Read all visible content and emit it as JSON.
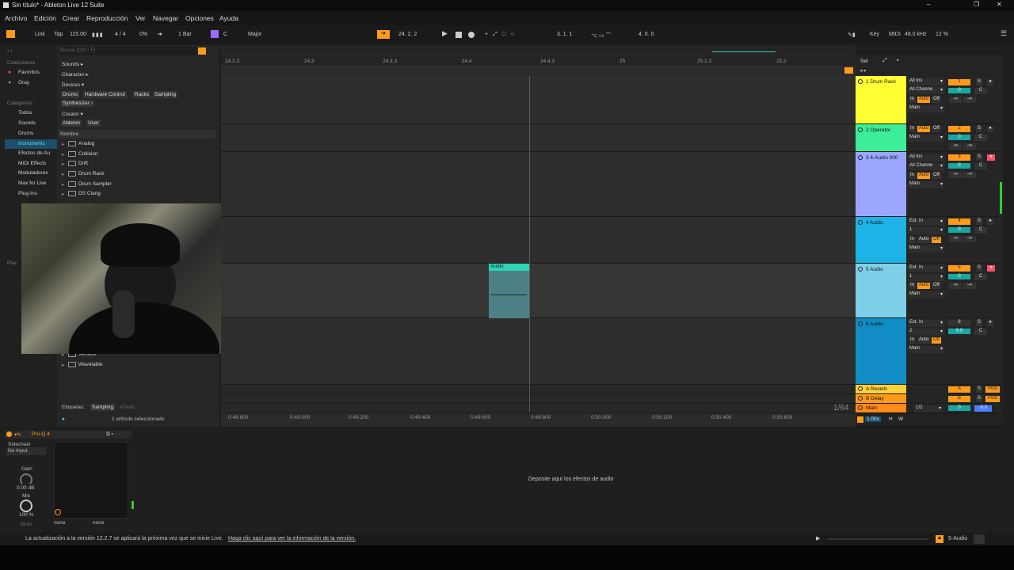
{
  "window": {
    "title": "Sin título* - Ableton Live 12 Suite",
    "min": "–",
    "max": "❐",
    "close": "✕"
  },
  "menu": [
    "Archivo",
    "Edición",
    "Crear",
    "Reproducción",
    "Ver",
    "Navegar",
    "Opciones",
    "Ayuda"
  ],
  "control": {
    "link": "Link",
    "tap": "Tap",
    "tempo": "115.00",
    "sig": "4 / 4",
    "groove": "0%",
    "quant": "1 Bar",
    "key": "C",
    "scale": "Major",
    "position": "24.  2.  2",
    "loop_start": "3.  1.  1",
    "loop_len": "4.  0.  0",
    "key_label": "Key",
    "midi_label": "MIDI",
    "sample_rate": "48.0 kHz",
    "cpu": "12 %"
  },
  "browser": {
    "search_placeholder": "Buscar (Ctrl + F)",
    "collections_header": "Colecciones",
    "favorites": "Favoritos",
    "gray": "Gray",
    "categories_header": "Categorías",
    "categories": [
      "Todos",
      "Sounds",
      "Drums",
      "Instruments",
      "Efectos de Au",
      "MIDI Effects",
      "Moduladores",
      "Max for Live",
      "Plug-Ins"
    ],
    "places_header": "Plac",
    "filters": {
      "sounds": "Sounds ▸",
      "character": "Character ▸",
      "devices": "Devices ▾",
      "device_tags": [
        "Drums",
        "Hardware Control",
        "Racks",
        "Sampling"
      ],
      "synth": "Synthesizer ›",
      "creator": "Creator ▾",
      "creator_tags": [
        "Ableton",
        "User"
      ]
    },
    "list_header": "Nombre",
    "items": [
      "Analog",
      "Collision",
      "Drift",
      "Drum Rack",
      "Drum Sampler",
      "DS Clang"
    ],
    "items_bottom": [
      "Tension",
      "Wavetable"
    ],
    "tags_label": "Etiquetas:",
    "tag_sampling": "Sampling",
    "tag_add": "Añadir...",
    "selected": "1 artículo seleccionado"
  },
  "ruler": [
    "24.2.3",
    "24.3",
    "24.3.3",
    "24.4",
    "24.4.3",
    "25",
    "25.1.3",
    "25.2"
  ],
  "time_ruler": [
    "0:48:800",
    "0:49:000",
    "0:49:200",
    "0:49:400",
    "0:49:600",
    "0:49:800",
    "0:50:000",
    "0:50:200",
    "0:50:400",
    "0:50:600"
  ],
  "zoom": "1/64",
  "set_label": "Set",
  "tracks": [
    {
      "name": "1 Drum Rack",
      "color": "#ffff33",
      "input": "All Ins",
      "channel": "All Channe",
      "num": "1",
      "vol": "0"
    },
    {
      "name": "2 Operator",
      "color": "#3ded97",
      "input": "",
      "channel": "",
      "num": "2",
      "vol": "0"
    },
    {
      "name": "3 4-Audio 000",
      "color": "#9aa6ff",
      "input": "All Ins",
      "channel": "All Channe",
      "num": "3",
      "vol": "0"
    },
    {
      "name": "4 Audio",
      "color": "#1eb3e6",
      "input": "Ext. In",
      "channel": "1",
      "num": "4",
      "vol": "0"
    },
    {
      "name": "5 Audio",
      "color": "#7ecfe8",
      "input": "Ext. In",
      "channel": "1",
      "num": "5",
      "vol": "0"
    },
    {
      "name": "6 Audio",
      "color": "#118cc4",
      "input": "Ext. In",
      "channel": "2",
      "num": "6",
      "vol": "6.0"
    }
  ],
  "returns": [
    {
      "name": "A Reverb",
      "num": "A",
      "post": "Post"
    },
    {
      "name": "B Delay",
      "num": "B",
      "post": "Post"
    }
  ],
  "main": {
    "name": "Main",
    "routing": "1/2",
    "vol": "0",
    "pan": "-6.0"
  },
  "clip": {
    "name": "Audio"
  },
  "mix_labels": {
    "in": "In",
    "auto": "Auto",
    "off": "Off",
    "main": "Main",
    "s": "S",
    "c": "C",
    "inf": "-∞"
  },
  "device": {
    "name": "Pro-Q 4",
    "sidechain": "Sidechain",
    "no_input": "No Input",
    "gain": "Gain",
    "gain_val": "0.00 dB",
    "mix": "Mix",
    "mix_val": "100 %",
    "mute": "Mute",
    "none1": "none",
    "none2": "none"
  },
  "drop_text": "Deposite aquí los efectos de audio",
  "status": {
    "message": "La actualización a la versión 12.2.7 se aplicará la próxima vez que se inicie Live.",
    "link": "Haga clic aquí para ver la información de la versión.",
    "track": "5-Audio"
  },
  "bottom_zoom": "1.00x",
  "hw": "H",
  "ww": "W",
  "colors": {
    "accent": "#ff9a1a",
    "teal": "#1aa7a0",
    "clip": "#2fd3b4"
  }
}
